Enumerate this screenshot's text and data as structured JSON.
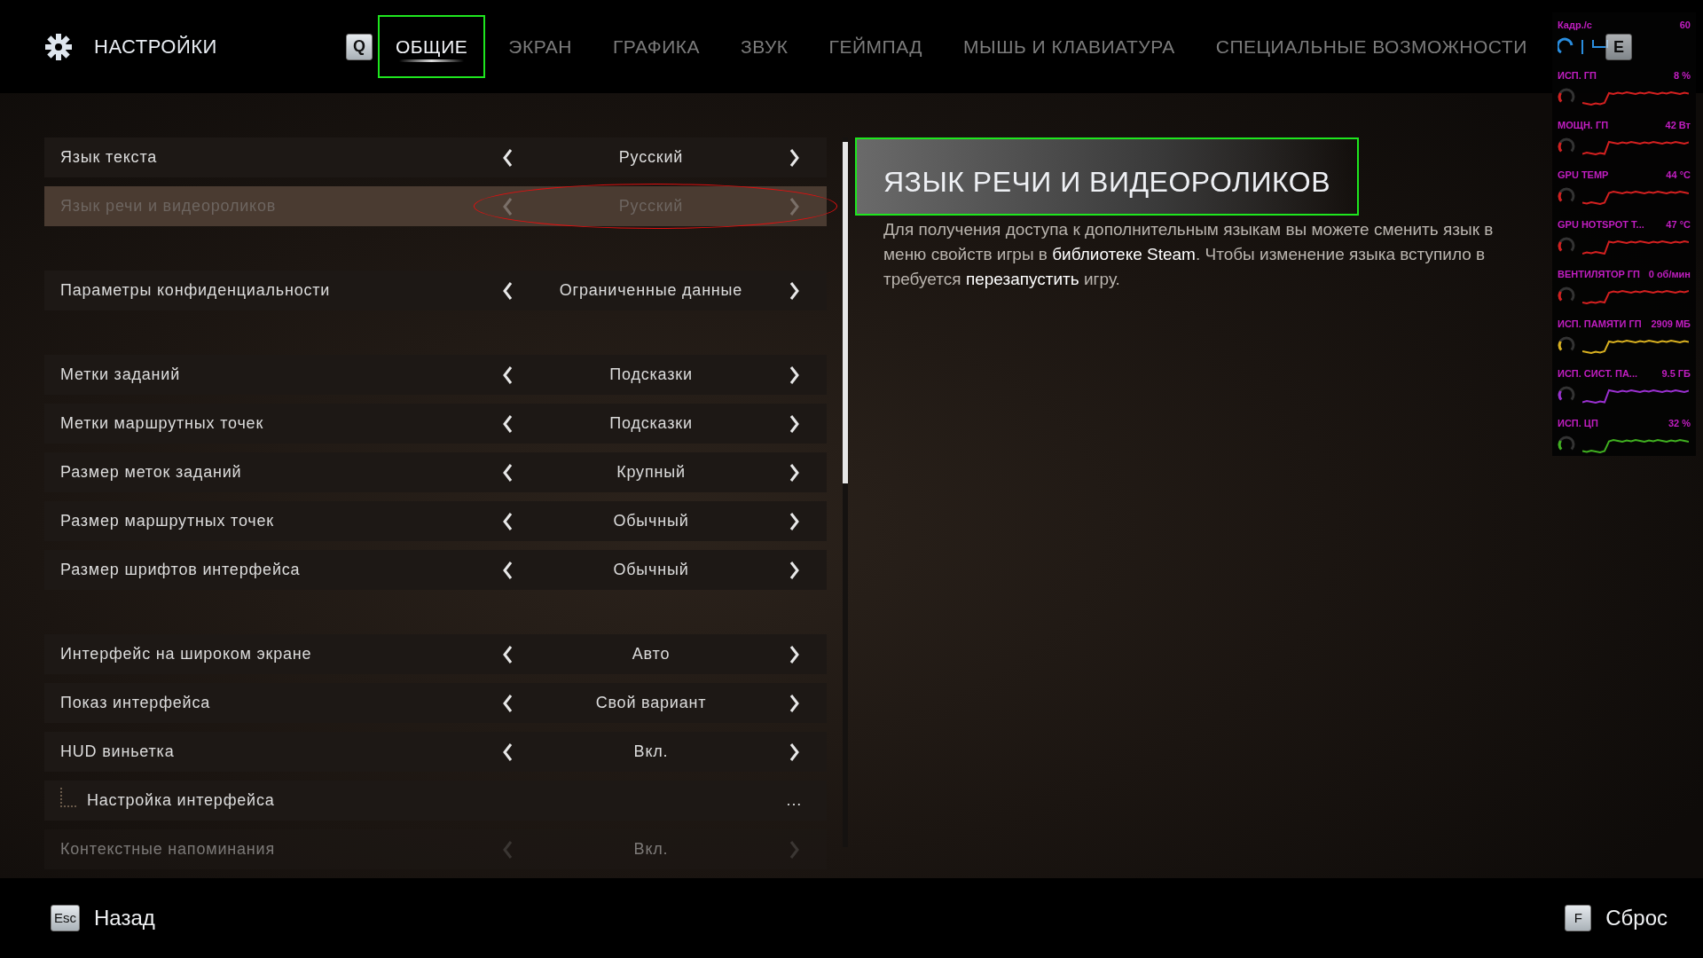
{
  "header": {
    "title": "НАСТРОЙКИ",
    "prev_key": "Q",
    "next_key": "E"
  },
  "tabs": [
    {
      "label": "ОБЩИЕ",
      "selected": true,
      "framed": true
    },
    {
      "label": "ЭКРАН",
      "selected": false,
      "framed": false
    },
    {
      "label": "ГРАФИКА",
      "selected": false,
      "framed": false
    },
    {
      "label": "ЗВУК",
      "selected": false,
      "framed": false
    },
    {
      "label": "ГЕЙМПАД",
      "selected": false,
      "framed": false
    },
    {
      "label": "МЫШЬ И КЛАВИАТУРА",
      "selected": false,
      "framed": false
    },
    {
      "label": "СПЕЦИАЛЬНЫЕ ВОЗМОЖНОСТИ",
      "selected": false,
      "framed": false
    }
  ],
  "settings": [
    {
      "rows": [
        {
          "kind": "option",
          "label": "Язык текста",
          "value": "Русский",
          "selected": false,
          "disabled": false,
          "circled": false
        },
        {
          "kind": "option",
          "label": "Язык речи и видеороликов",
          "value": "Русский",
          "selected": true,
          "disabled": true,
          "circled": true
        }
      ]
    },
    {
      "rows": [
        {
          "kind": "option",
          "label": "Параметры конфиденциальности",
          "value": "Ограниченные данные",
          "selected": false,
          "disabled": false,
          "circled": false
        }
      ]
    },
    {
      "rows": [
        {
          "kind": "option",
          "label": "Метки заданий",
          "value": "Подсказки",
          "selected": false,
          "disabled": false,
          "circled": false
        },
        {
          "kind": "option",
          "label": "Метки маршрутных точек",
          "value": "Подсказки",
          "selected": false,
          "disabled": false,
          "circled": false
        },
        {
          "kind": "option",
          "label": "Размер меток заданий",
          "value": "Крупный",
          "selected": false,
          "disabled": false,
          "circled": false
        },
        {
          "kind": "option",
          "label": "Размер маршрутных точек",
          "value": "Обычный",
          "selected": false,
          "disabled": false,
          "circled": false
        },
        {
          "kind": "option",
          "label": "Размер шрифтов интерфейса",
          "value": "Обычный",
          "selected": false,
          "disabled": false,
          "circled": false
        }
      ]
    },
    {
      "rows": [
        {
          "kind": "option",
          "label": "Интерфейс на широком экране",
          "value": "Авто",
          "selected": false,
          "disabled": false,
          "circled": false
        },
        {
          "kind": "option",
          "label": "Показ интерфейса",
          "value": "Свой вариант",
          "selected": false,
          "disabled": false,
          "circled": false
        },
        {
          "kind": "option",
          "label": "HUD виньетка",
          "value": "Вкл.",
          "selected": false,
          "disabled": false,
          "circled": false
        },
        {
          "kind": "submenu",
          "label": "Настройка интерфейса",
          "value": "...",
          "selected": false,
          "disabled": false,
          "circled": false
        },
        {
          "kind": "option",
          "label": "Контекстные напоминания",
          "value": "Вкл.",
          "selected": false,
          "disabled": true,
          "circled": false
        }
      ]
    }
  ],
  "detail": {
    "title": "ЯЗЫК РЕЧИ И ВИДЕОРОЛИКОВ",
    "framed": true,
    "lines": [
      "Для получения доступа к дополнительным языкам вы можете сменить язык в",
      "меню свойств игры в **библиотеке Steam**. Чтобы изменение языка вступило в",
      "требуется **перезапустить** игру."
    ]
  },
  "overlay": {
    "fps_label": "Кадр./с",
    "fps_value": "60",
    "metrics": [
      {
        "label": "ИСП. ГП",
        "value": "8 %",
        "color": "#d42020"
      },
      {
        "label": "МОЩН. ГП",
        "value": "42 Вт",
        "color": "#d42020"
      },
      {
        "label": "GPU TEMP",
        "value": "44 °C",
        "color": "#d42020"
      },
      {
        "label": "GPU HOTSPOT T...",
        "value": "47 °C",
        "color": "#d42020"
      },
      {
        "label": "ВЕНТИЛЯТОР ГП",
        "value": "0 об/мин",
        "color": "#d42020"
      },
      {
        "label": "ИСП. ПАМЯТИ ГП",
        "value": "2909 МБ",
        "color": "#d8b020"
      },
      {
        "label": "ИСП. СИСТ. ПА...",
        "value": "9.5 ГБ",
        "color": "#9a30d0"
      },
      {
        "label": "ИСП. ЦП",
        "value": "32 %",
        "color": "#40b020"
      }
    ]
  },
  "footer": {
    "back": {
      "key": "Esc",
      "label": "Назад"
    },
    "reset": {
      "key": "F",
      "label": "Сброс"
    }
  }
}
